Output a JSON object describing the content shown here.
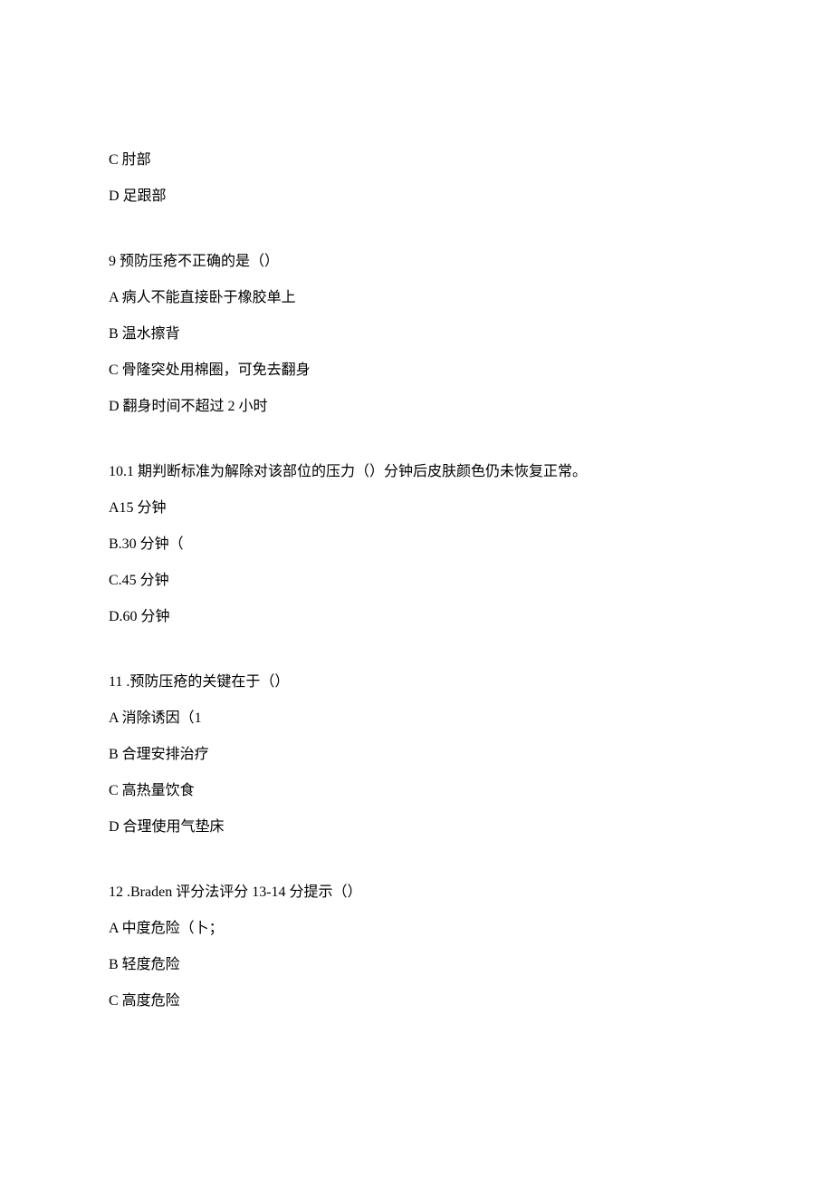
{
  "q8": {
    "optC": "C 肘部",
    "optD": "D 足跟部"
  },
  "q9": {
    "stem": "9 预防压疮不正确的是（）",
    "optA": "A 病人不能直接卧于橡胶单上",
    "optB": "B 温水擦背",
    "optC": "C 骨隆突处用棉圈，可免去翻身",
    "optD": "D 翻身时间不超过 2 小时"
  },
  "q10": {
    "stem": "10.1 期判断标准为解除对该部位的压力（）分钟后皮肤颜色仍未恢复正常。",
    "optA": "A15 分钟",
    "optB": "B.30 分钟（",
    "optC": "C.45 分钟",
    "optD": "D.60 分钟"
  },
  "q11": {
    "stem": "11  .预防压疮的关键在于（）",
    "optA": "A 消除诱因（1",
    "optB": "B 合理安排治疗",
    "optC": "C 高热量饮食",
    "optD": "D 合理使用气垫床"
  },
  "q12": {
    "stem": "12  .Braden 评分法评分 13-14 分提示（）",
    "optA": "A 中度危险（卜；",
    "optB": "B 轻度危险",
    "optC": "C 高度危险"
  }
}
